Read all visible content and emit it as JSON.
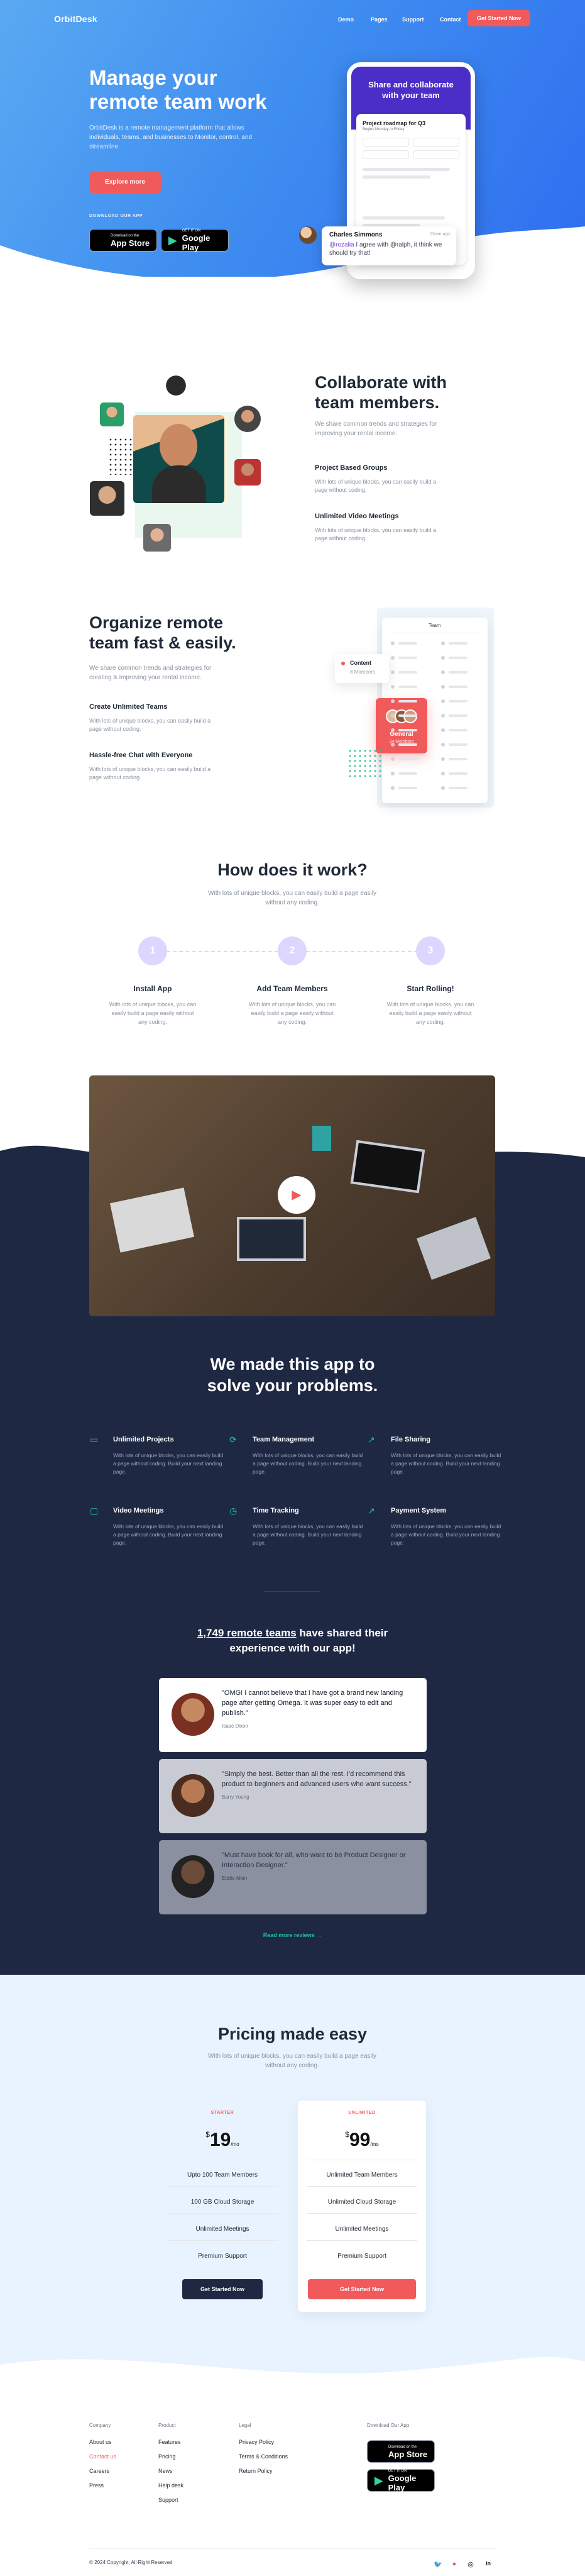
{
  "nav": {
    "logo": "OrbitDesk",
    "links": [
      "Demo",
      "Pages",
      "Support",
      "Contact"
    ],
    "cta": "Get Started Now"
  },
  "hero": {
    "title": "Manage your remote team work",
    "text": "OrbitDesk is a remote management platform that allows individuals, teams, and businesses to Monitor, control, and streamline.",
    "cta": "Explore more",
    "download_label": "DOWNLOAD OUR APP",
    "appstore_small": "Download on the",
    "appstore_big": "App Store",
    "gplay_small": "GET IT ON",
    "gplay_big": "Google Play",
    "phone_header": "Share and collaborate with your team",
    "phone_card_title": "Project roadmap for Q3",
    "phone_card_sub": "Begins Monday to Friday",
    "bubble_name": "Charles Simmons",
    "bubble_time": "11min ago",
    "bubble_mention": "@rozalia",
    "bubble_msg": "I agree with @ralph, it think we should try that!"
  },
  "collab": {
    "title": "Collaborate with team members.",
    "text": "We share common trends and strategies for improving your rental income.",
    "f1_title": "Project Based Groups",
    "f1_text": "With lots of unique blocks, you can easily build a page without coding.",
    "f2_title": "Unlimited Video Meetings",
    "f2_text": "With lots of unique blocks, you can easily build a page without coding."
  },
  "organize": {
    "title": "Organize remote team fast & easily.",
    "text": "We share common trends and strategies for creating & improving your rental income.",
    "f1_title": "Create Unlimited Teams",
    "f1_text": "With lots of unique blocks, you can easily build a page without coding.",
    "f2_title": "Hassle-free Chat with Everyone",
    "f2_text": "With lots of unique blocks, you can easily build a page without coding.",
    "panel_title": "Team",
    "tag1_title": "Content",
    "tag1_sub": "8 Members",
    "tag2_title": "General",
    "tag2_sub": "34 Members"
  },
  "how": {
    "title": "How does it work?",
    "text": "With lots of unique blocks, you can easily build a page easily without any coding.",
    "steps": [
      {
        "num": "1",
        "title": "Install App",
        "text": "With lots of unique blocks, you can easily build a page easily without any coding."
      },
      {
        "num": "2",
        "title": "Add Team Members",
        "text": "With lots of unique blocks, you can easily build a page easily without any coding."
      },
      {
        "num": "3",
        "title": "Start Rolling!",
        "text": "With lots of unique blocks, you can easily build a page easily without any coding."
      }
    ]
  },
  "solve": {
    "title": "We made this app to solve your problems.",
    "features": [
      {
        "title": "Unlimited Projects",
        "text": "With lots of unique blocks, you can easily build a page without coding. Build your next landing page."
      },
      {
        "title": "Team Management",
        "text": "With lots of unique blocks, you can easily build a page without coding. Build your next landing page."
      },
      {
        "title": "File Sharing",
        "text": "With lots of unique blocks, you can easily build a page without coding. Build your next landing page."
      },
      {
        "title": "Video Meetings",
        "text": "With lots of unique blocks, you can easily build a page without coding. Build your next landing page."
      },
      {
        "title": "Time Tracking",
        "text": "With lots of unique blocks, you can easily build a page without coding. Build your next landing page."
      },
      {
        "title": "Payment System",
        "text": "With lots of unique blocks, you can easily build a page without coding. Build your next landing page."
      }
    ]
  },
  "reviews": {
    "title_link": "1,749 remote teams",
    "title_rest": " have shared their experience with our app!",
    "items": [
      {
        "text": "\"OMG! I cannot believe that I have got a brand new landing page after getting Omega. It was super easy to edit and publish.\"",
        "name": "Isaac Dixon"
      },
      {
        "text": "\"Simply the best. Better than all the rest. I'd recommend this product to beginners and advanced users who want success.\"",
        "name": "Barry Young"
      },
      {
        "text": "\"Must have book for all, who want to be Product Designer or Interaction Designer.\"",
        "name": "Eddie Allen"
      }
    ],
    "more": "Read more reviews →"
  },
  "pricing": {
    "title": "Pricing made easy",
    "text": "With lots of unique blocks, you can easily build a page easily without any coding.",
    "plans": [
      {
        "name": "STARTER",
        "currency": "$",
        "price": "19",
        "period": "/mo",
        "features": [
          "Upto 100 Team Members",
          "100 GB Cloud Storage",
          "Unlimited Meetings",
          "Premium Support"
        ],
        "cta": "Get Started Now"
      },
      {
        "name": "UNLIMITED",
        "currency": "$",
        "price": "99",
        "period": "/mo",
        "features": [
          "Unlimited Team Members",
          "Unlimited Cloud Storage",
          "Unlimited Meetings",
          "Premium Support"
        ],
        "cta": "Get Started Now"
      }
    ]
  },
  "footer": {
    "col1_title": "Company",
    "col1": [
      "About us",
      "Contact us",
      "Careers",
      "Press"
    ],
    "col2_title": "Product",
    "col2": [
      "Features",
      "Pricing",
      "News",
      "Help desk",
      "Support"
    ],
    "col3_title": "Legal",
    "col3": [
      "Privacy Policy",
      "Terms & Conditions",
      "Return Policy"
    ],
    "col4_title": "Download Our App",
    "copyright": "© 2024 Copyright, All Right Reserved"
  },
  "colors": {
    "accent": "#f15a5a",
    "brand": "#3f8ef0",
    "green": "#22c39a",
    "purple": "#7c3aed",
    "dark": "#1e2843"
  }
}
